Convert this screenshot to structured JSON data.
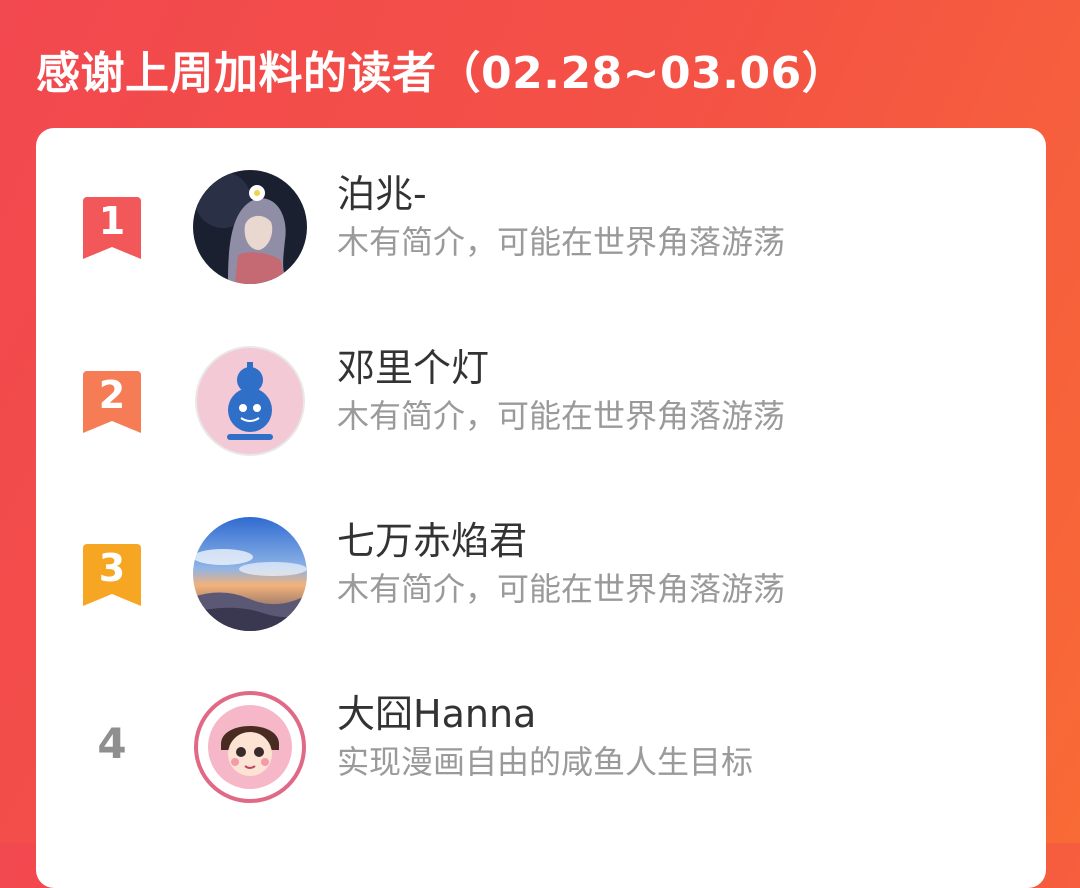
{
  "header": {
    "title": "感谢上周加料的读者（02.28~03.06）"
  },
  "colors": {
    "background_start": "#f2484f",
    "background_end": "#f86a36",
    "rank1": "#f2585a",
    "rank2": "#f57c55",
    "rank3": "#f6a623",
    "rank4_text": "#8f8f8f"
  },
  "readers": [
    {
      "rank": "1",
      "name": "泊兆-",
      "bio": "木有简介，可能在世界角落游荡",
      "avatar_icon": "anime-girl-avatar"
    },
    {
      "rank": "2",
      "name": "邓里个灯",
      "bio": "木有简介，可能在世界角落游荡",
      "avatar_icon": "gourd-avatar"
    },
    {
      "rank": "3",
      "name": "七万赤焰君",
      "bio": "木有简介，可能在世界角落游荡",
      "avatar_icon": "sky-clouds-avatar"
    },
    {
      "rank": "4",
      "name": "大囧Hanna",
      "bio": "实现漫画自由的咸鱼人生目标",
      "avatar_icon": "cartoon-girl-avatar"
    }
  ]
}
